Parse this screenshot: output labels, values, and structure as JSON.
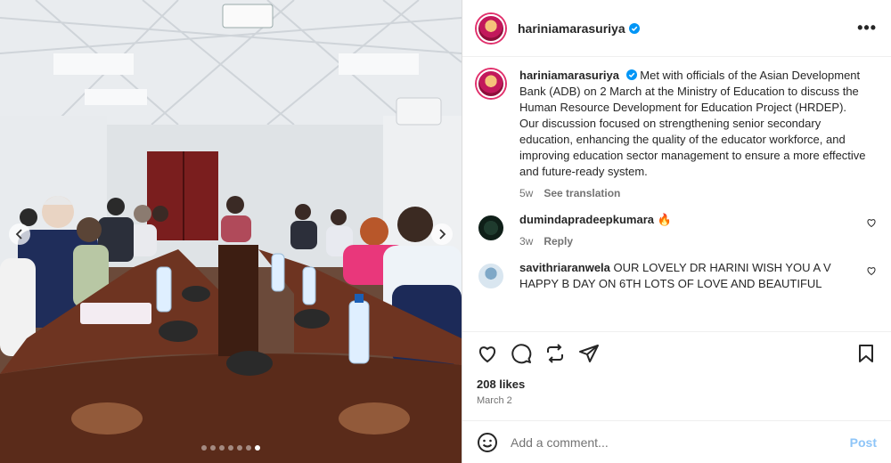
{
  "post": {
    "username": "hariniamarasuriya",
    "more_label": "•••",
    "caption": {
      "username": "hariniamarasuriya",
      "text_p1": "Met with officials of the Asian Development Bank (ADB) on 2 March at the Ministry of Education to discuss the Human Resource Development for Education Project (HRDEP).",
      "text_p2": "Our discussion focused on strengthening senior secondary education, enhancing the quality of the educator workforce, and improving education sector management to ensure a more effective and future-ready system.",
      "age": "5w",
      "translate": "See translation"
    },
    "comments": [
      {
        "username": "dumindapradeepkumara",
        "text": "🔥",
        "age": "3w",
        "reply": "Reply"
      },
      {
        "username": "savithriaranwela",
        "text": "OUR LOVELY DR HARINI WISH YOU A V HAPPY B DAY ON 6TH LOTS OF LOVE AND BEAUTIFUL"
      }
    ],
    "likes": "208 likes",
    "date": "March 2",
    "comment_placeholder": "Add a comment...",
    "post_label": "Post"
  },
  "media": {
    "carousel_dots": 7,
    "active_dot": 6
  },
  "colors": {
    "accent": "#0095f6",
    "post_disabled": "#8ec5f8",
    "verified": "#0095f6"
  },
  "icons": [
    "verified-badge-icon",
    "more-icon",
    "heart-icon",
    "comment-icon",
    "repost-icon",
    "share-icon",
    "bookmark-icon",
    "emoji-icon",
    "chevron-left-icon",
    "chevron-right-icon"
  ]
}
